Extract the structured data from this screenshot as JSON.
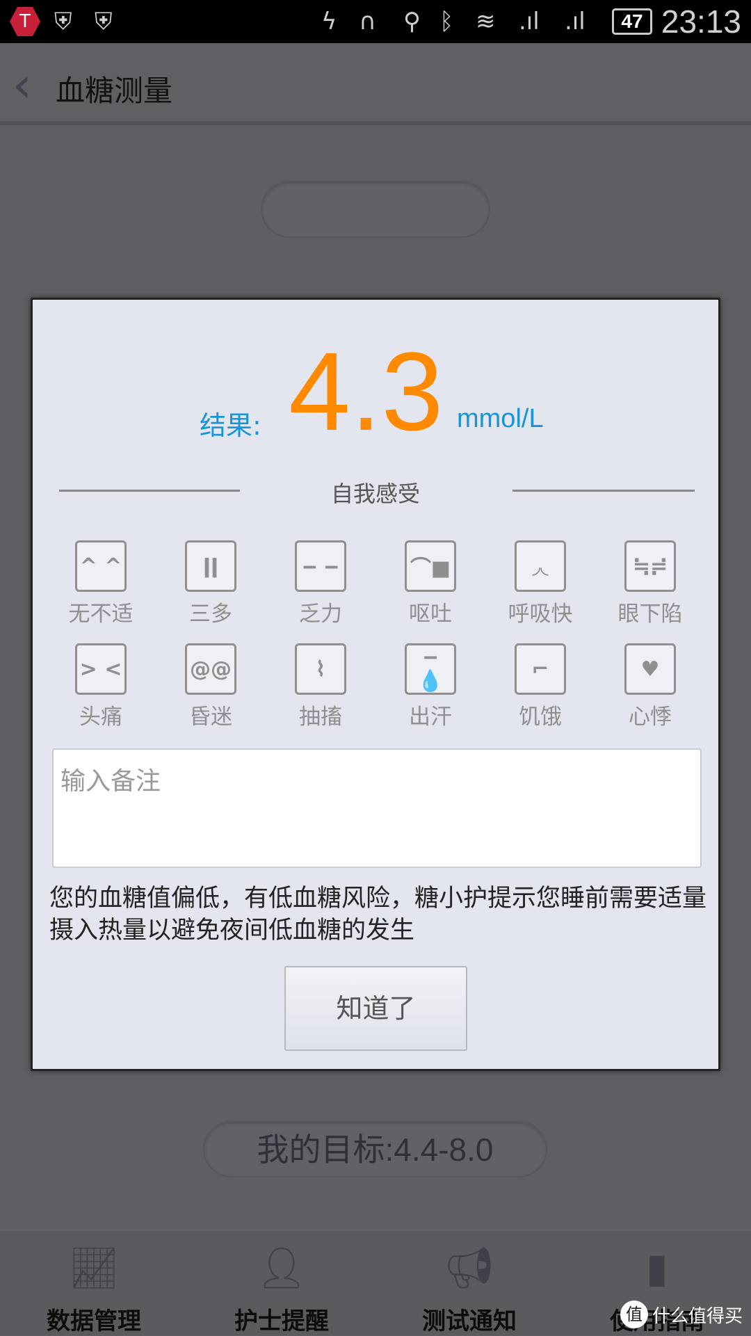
{
  "status_bar": {
    "time": "23:13",
    "battery": "47",
    "icons": [
      "app-badge-icon",
      "shield-icon",
      "shield-lock-icon",
      "flash-icon",
      "headphones-icon",
      "location-icon",
      "bluetooth-icon",
      "wifi-icon",
      "signal-icon",
      "signal-icon"
    ]
  },
  "header": {
    "title": "血糖测量",
    "back_icon": "chevron-left-icon"
  },
  "dialog": {
    "result_label": "结果:",
    "result_value": "4.3",
    "result_unit": "mmol/L",
    "feeling_title": "自我感受",
    "symptoms": [
      {
        "label": "无不适",
        "icon": "^ ^"
      },
      {
        "label": "三多",
        "icon": "ǀǀ"
      },
      {
        "label": "乏力",
        "icon": "‒ ‒"
      },
      {
        "label": "呕吐",
        "icon": "⌒■"
      },
      {
        "label": "呼吸快",
        "icon": "◞◟"
      },
      {
        "label": "眼下陷",
        "icon": "≒≓"
      },
      {
        "label": "头痛",
        "icon": "> <"
      },
      {
        "label": "昏迷",
        "icon": "@@"
      },
      {
        "label": "抽搐",
        "icon": "⌇"
      },
      {
        "label": "出汗",
        "icon": "‒ 💧"
      },
      {
        "label": "饥饿",
        "icon": "⌐"
      },
      {
        "label": "心悸",
        "icon": "♥"
      }
    ],
    "note_placeholder": "输入备注",
    "message": "您的血糖值偏低，有低血糖风险，糖小护提示您睡前需要适量摄入热量以避免夜间低血糖的发生",
    "ok_label": "知道了"
  },
  "goal": "我的目标:4.4-8.0",
  "nav": [
    {
      "label": "数据管理",
      "icon": "chart-icon"
    },
    {
      "label": "护士提醒",
      "icon": "nurse-icon"
    },
    {
      "label": "测试通知",
      "icon": "megaphone-icon"
    },
    {
      "label": "使用指南",
      "icon": "notebook-icon"
    }
  ],
  "watermark": {
    "logo": "值",
    "text": "什么值得买"
  },
  "colors": {
    "result": "#ff8a00",
    "accent": "#1795d6"
  }
}
